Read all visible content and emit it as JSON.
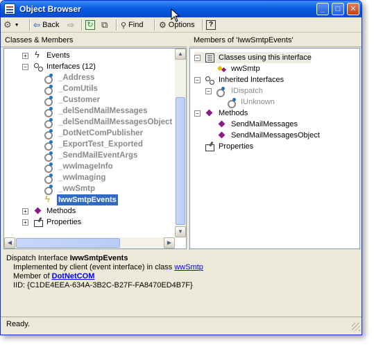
{
  "window": {
    "title": "Object Browser"
  },
  "titlebar_buttons": {
    "minimize": "_",
    "maximize": "□",
    "close": "✕"
  },
  "toolbar": {
    "back_label": "Back",
    "find_label": "Find",
    "options_label": "Options",
    "help_label": "?"
  },
  "left_pane": {
    "header": "Classes & Members",
    "items": [
      {
        "label": "Events",
        "icon": "events-icon",
        "expander": "+"
      },
      {
        "label": "Interfaces (12)",
        "icon": "interfaces-node-icon",
        "expander": "−"
      },
      {
        "label": "_Address",
        "icon": "interface-icon"
      },
      {
        "label": "_ComUtils",
        "icon": "interface-icon"
      },
      {
        "label": "_Customer",
        "icon": "interface-icon"
      },
      {
        "label": "_delSendMailMessages",
        "icon": "interface-icon"
      },
      {
        "label": "_delSendMailMessagesObject",
        "icon": "interface-icon"
      },
      {
        "label": "_DotNetComPublisher",
        "icon": "interface-icon"
      },
      {
        "label": "_ExportTest_Exported",
        "icon": "interface-icon"
      },
      {
        "label": "_SendMailEventArgs",
        "icon": "interface-icon"
      },
      {
        "label": "_wwImageInfo",
        "icon": "interface-icon"
      },
      {
        "label": "_wwImaging",
        "icon": "interface-icon"
      },
      {
        "label": "_wwSmtp",
        "icon": "interface-icon"
      },
      {
        "label": "IwwSmtpEvents",
        "icon": "event-interface-icon",
        "selected": true
      },
      {
        "label": "Methods",
        "icon": "methods-node-icon",
        "expander": "+"
      },
      {
        "label": "Properties",
        "icon": "properties-node-icon",
        "expander": "+"
      }
    ]
  },
  "right_pane": {
    "header": "Members of 'IwwSmtpEvents'",
    "items": [
      {
        "label": "Classes using this interface",
        "icon": "list-icon",
        "expander": "−"
      },
      {
        "label": "wwSmtp",
        "icon": "class-icon"
      },
      {
        "label": "Inherited Interfaces",
        "icon": "interfaces-node-icon",
        "expander": "−"
      },
      {
        "label": "IDispatch",
        "icon": "interface-icon",
        "expander": "−"
      },
      {
        "label": "IUnknown",
        "icon": "interface-icon"
      },
      {
        "label": "Methods",
        "icon": "methods-node-icon",
        "expander": "−"
      },
      {
        "label": "SendMailMessages",
        "icon": "method-icon"
      },
      {
        "label": "SendMailMessagesObject",
        "icon": "method-icon"
      },
      {
        "label": "Properties",
        "icon": "properties-node-icon"
      }
    ]
  },
  "details": {
    "prefix": "Dispatch Interface ",
    "name": "IwwSmtpEvents",
    "implemented_prefix": "Implemented by client (event interface) in class ",
    "implemented_class": "wwSmtp",
    "member_prefix": "Member of ",
    "member_of": "DotNetCOM",
    "iid": "IID: {C1DE4EEA-634A-3B2C-B27F-FA8470ED4B7F}"
  },
  "status": {
    "text": "Ready."
  },
  "colors": {
    "selection": "#316ac5",
    "title_bar": "#0a5fe3",
    "link": "#0000ff",
    "disabled_text": "#8a8a8a"
  }
}
